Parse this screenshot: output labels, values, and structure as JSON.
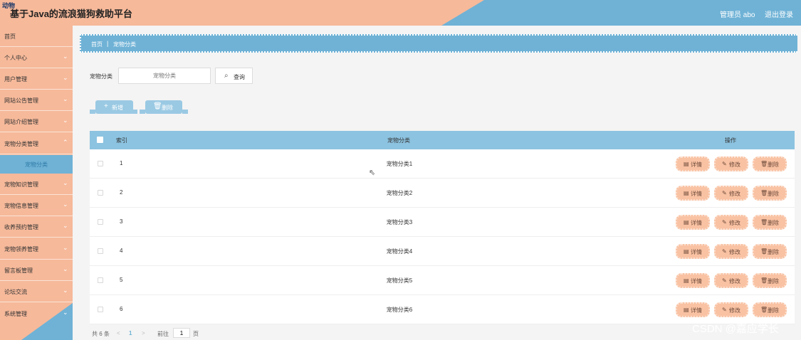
{
  "header": {
    "logo_text": "动物",
    "title": "基于Java的流浪猫狗救助平台",
    "admin": "管理员 abo",
    "logout": "退出登录"
  },
  "sidebar": {
    "items": [
      {
        "label": "首页"
      },
      {
        "label": "个人中心"
      },
      {
        "label": "用户管理"
      },
      {
        "label": "网站公告管理"
      },
      {
        "label": "网站介绍管理"
      },
      {
        "label": "宠物分类管理"
      },
      {
        "label": "宠物知识管理"
      },
      {
        "label": "宠物信息管理"
      },
      {
        "label": "收养预约管理"
      },
      {
        "label": "宠物领养管理"
      },
      {
        "label": "留言板管理"
      },
      {
        "label": "论坛交流"
      },
      {
        "label": "系统管理"
      }
    ],
    "active_sub": "宠物分类"
  },
  "breadcrumb": {
    "home": "首页",
    "separator": "|",
    "current": "宠物分类"
  },
  "search": {
    "label": "宠物分类",
    "placeholder": "宠物分类",
    "button": "查询"
  },
  "actions": {
    "add": "新增",
    "delete": "删除"
  },
  "table": {
    "headers": {
      "index": "索引",
      "category": "宠物分类",
      "ops": "操作"
    },
    "rows": [
      {
        "index": "1",
        "category": "宠物分类1"
      },
      {
        "index": "2",
        "category": "宠物分类2"
      },
      {
        "index": "3",
        "category": "宠物分类3"
      },
      {
        "index": "4",
        "category": "宠物分类4"
      },
      {
        "index": "5",
        "category": "宠物分类5"
      },
      {
        "index": "6",
        "category": "宠物分类6"
      }
    ],
    "op_labels": {
      "detail": "详情",
      "edit": "修改",
      "delete": "删除"
    }
  },
  "pager": {
    "total": "共 6 条",
    "prev": "<",
    "current": "1",
    "next": ">",
    "goto": "前往",
    "page_value": "1",
    "unit": "页"
  },
  "watermark": "CSDN @嘉应学长",
  "colors": {
    "salmon": "#f6b99a",
    "blue": "#6fb2d6",
    "table_head": "#8cc3e0"
  }
}
